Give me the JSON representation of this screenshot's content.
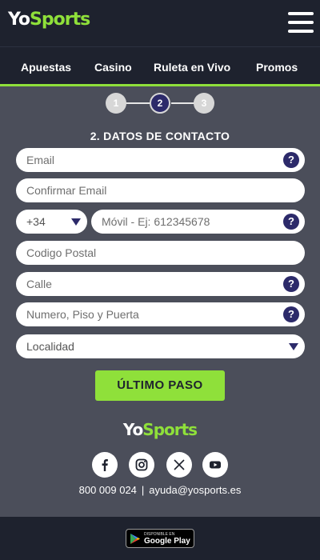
{
  "header": {
    "logo_yo": "Yo",
    "logo_sports": "Sports"
  },
  "nav": {
    "items": [
      "Apuestas",
      "Casino",
      "Ruleta en Vivo",
      "Promos"
    ]
  },
  "steps": {
    "labels": [
      "1",
      "2",
      "3"
    ],
    "active": 2
  },
  "form": {
    "title": "2. DATOS DE CONTACTO",
    "email_placeholder": "Email",
    "confirm_email_placeholder": "Confirmar Email",
    "prefix_value": "+34",
    "mobile_placeholder": "Móvil - Ej: 612345678",
    "postal_placeholder": "Codigo Postal",
    "street_placeholder": "Calle",
    "number_placeholder": "Numero, Piso y Puerta",
    "locality_value": "Localidad",
    "help_glyph": "?",
    "submit_label": "ÚLTIMO PASO"
  },
  "footer": {
    "logo_yo": "Yo",
    "logo_sports": "Sports",
    "social_icons": [
      "facebook-icon",
      "instagram-icon",
      "x-icon",
      "youtube-icon"
    ],
    "phone": "800 009 024",
    "separator": "|",
    "email": "ayuda@yosports.es",
    "store_badge_small": "DISPONIBLE EN",
    "store_badge_big": "Google Play"
  },
  "colors": {
    "accent": "#8fe03a",
    "dark": "#1e222e",
    "body": "#4b4e5a",
    "help": "#2c2a6a"
  }
}
